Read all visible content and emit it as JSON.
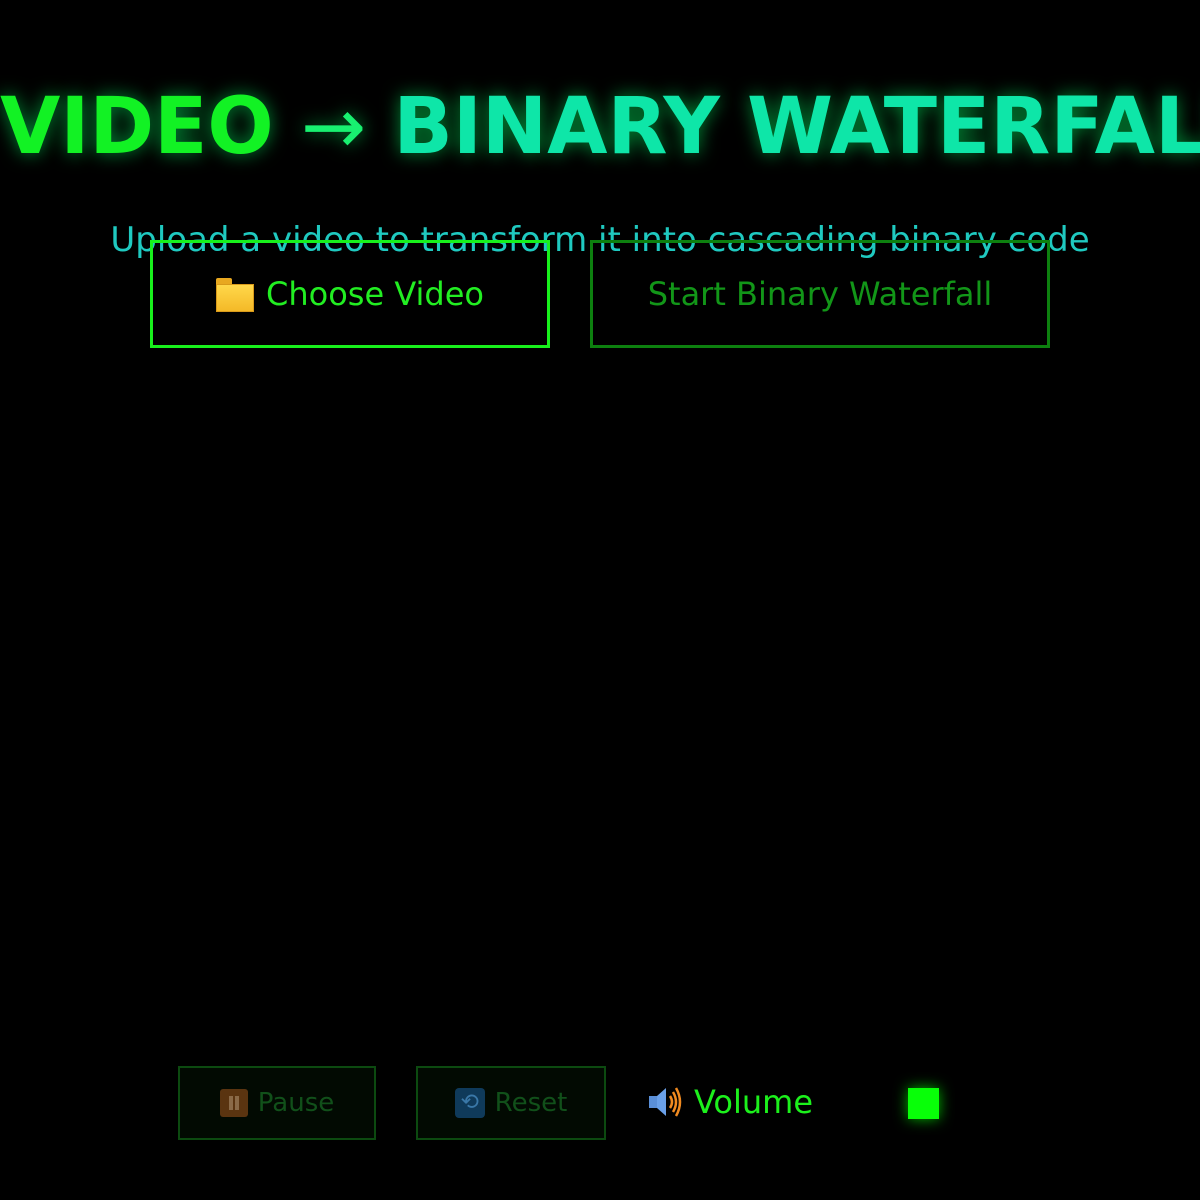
{
  "header": {
    "title_left": "VIDEO",
    "title_arrow": "→",
    "title_right": "BINARY WATERFALL",
    "subtitle": "Upload a video to transform it into cascading binary code"
  },
  "actions": {
    "choose_label": "Choose Video",
    "choose_icon": "folder-icon",
    "start_label": "Start Binary Waterfall"
  },
  "controls": {
    "pause_label": "Pause",
    "pause_icon": "pause-icon",
    "reset_label": "Reset",
    "reset_icon": "reset-icon",
    "volume_label": "Volume",
    "volume_icon": "speaker-icon"
  },
  "colors": {
    "accent": "#18f01c",
    "accent_teal": "#0ee6a8",
    "subtitle": "#1fc9c0",
    "disabled": "#0d800f",
    "background": "#000000"
  }
}
